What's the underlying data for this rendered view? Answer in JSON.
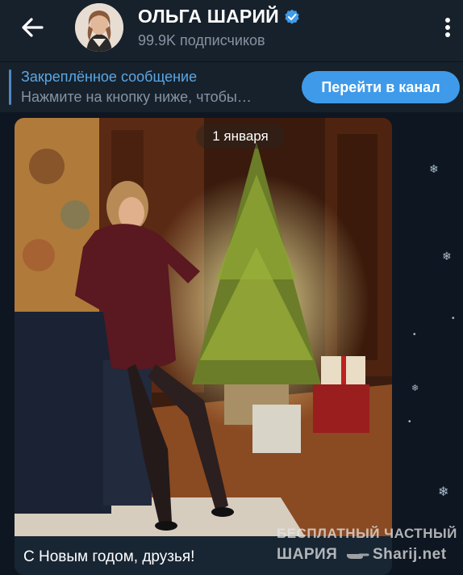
{
  "header": {
    "channel_name": "ОЛЬГА ШАРИЙ",
    "subscribers": "99.9K подписчиков",
    "back_icon": "arrow-left-icon",
    "menu_icon": "vertical-dots-icon",
    "verified_icon": "verified-badge-icon"
  },
  "pinned": {
    "title": "Закреплённое сообщение",
    "text": "Нажмите на кнопку ниже, чтобы…",
    "button_label": "Перейти в канал"
  },
  "message": {
    "date": "1 января",
    "caption": "С Новым годом, друзья!"
  },
  "watermark": {
    "line1": "БЕСПЛАТНЫЙ ЧАСТНЫЙ",
    "line2": "ШАРИЯ",
    "line3": "Sharij.net"
  },
  "colors": {
    "accent": "#3f9be9",
    "header_bg": "#17212b",
    "chat_bg": "#0e1621"
  }
}
